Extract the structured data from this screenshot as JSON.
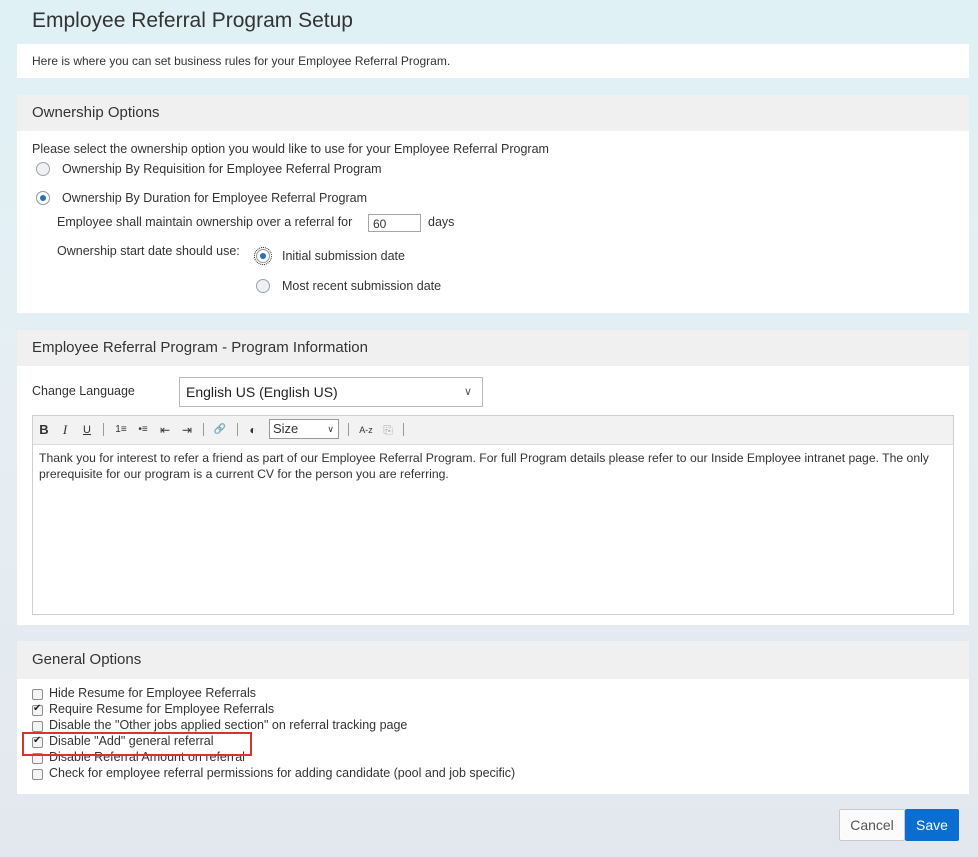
{
  "page": {
    "title": "Employee Referral Program Setup",
    "intro": "Here is where you can set business rules for your Employee Referral Program."
  },
  "ownership": {
    "heading": "Ownership Options",
    "prompt": "Please select the ownership option you would like to use for your Employee Referral Program",
    "option_requisition": "Ownership By Requisition for Employee Referral Program",
    "option_duration": "Ownership By Duration for Employee Referral Program",
    "selected": "duration",
    "maintain_label": "Employee shall maintain ownership over a referral for",
    "days_value": "60",
    "days_unit": "days",
    "start_label": "Ownership start date should use:",
    "start_initial": "Initial submission date",
    "start_recent": "Most recent submission date",
    "start_selected": "initial"
  },
  "program_info": {
    "heading": "Employee Referral Program - Program Information",
    "language_label": "Change Language",
    "language_value": "English US (English US)",
    "toolbar": {
      "bold": "B",
      "italic": "I",
      "underline": "U",
      "ordered_list": "1≡",
      "bullet_list": "•≡",
      "outdent": "⇤",
      "indent": "⇥",
      "link": "🔗",
      "color": "◐",
      "size_label": "Size",
      "format": "A-z",
      "remove": "⎘"
    },
    "body_text": "Thank you for interest to refer a friend as part of our Employee Referral Program. For full Program details please refer to our Inside Employee intranet page. The only prerequisite for our program is a current CV for the person you are referring."
  },
  "general": {
    "heading": "General Options",
    "options": [
      {
        "label": "Hide Resume for Employee Referrals",
        "checked": false
      },
      {
        "label": "Require Resume for Employee Referrals",
        "checked": true
      },
      {
        "label": "Disable the \"Other jobs applied section\" on referral tracking page",
        "checked": false
      },
      {
        "label": "Disable \"Add\" general referral",
        "checked": true
      },
      {
        "label": "Disable Referral Amount on referral",
        "checked": false
      },
      {
        "label": "Check for employee referral permissions for adding candidate (pool and job specific)",
        "checked": false
      }
    ]
  },
  "actions": {
    "cancel": "Cancel",
    "save": "Save"
  },
  "colors": {
    "primary": "#0a6ed1",
    "highlight": "#d9342b",
    "radio_selected": "#2a6fb6"
  }
}
